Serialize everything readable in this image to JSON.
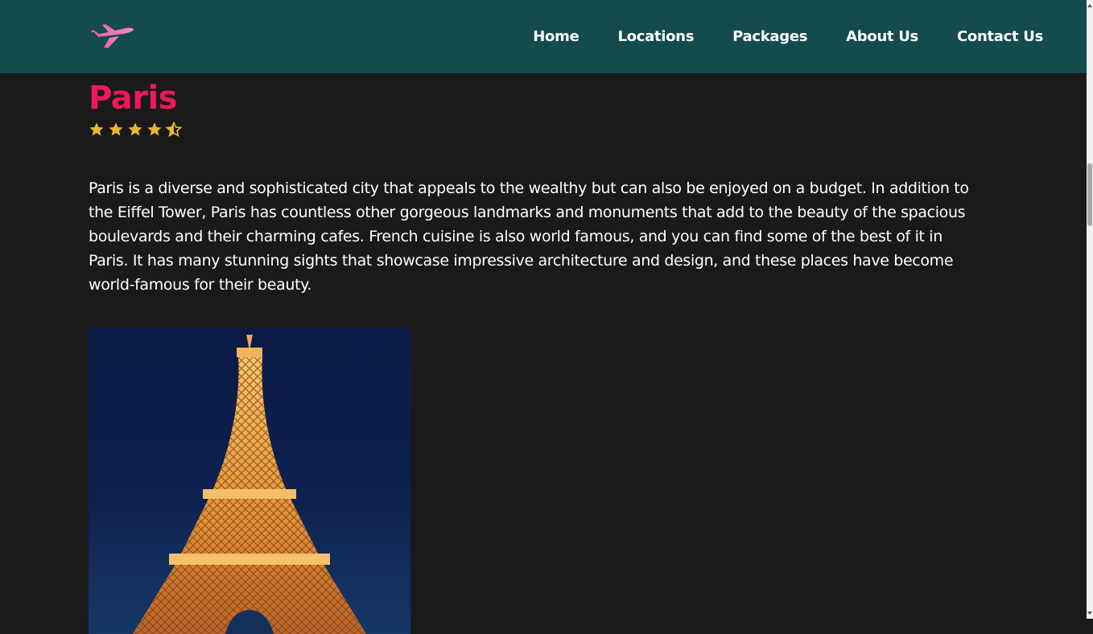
{
  "nav": {
    "logo_icon": "airplane-icon",
    "links": [
      "Home",
      "Locations",
      "Packages",
      "About Us",
      "Contact Us"
    ]
  },
  "destination": {
    "title": "Paris",
    "rating": 4.5,
    "rating_max": 5,
    "description": "Paris is a diverse and sophisticated city that appeals to the wealthy but can also be enjoyed on a budget. In addition to the Eiffel Tower, Paris has countless other gorgeous landmarks and monuments that add to the beauty of the spacious boulevards and their charming cafes. French cuisine is also world famous, and you can find some of the best of it in Paris. It has many stunning sights that showcase impressive architecture and design, and these places have become world-famous for their beauty."
  },
  "colors": {
    "navbar": "#144b4d",
    "background": "#1a1a1a",
    "title": "#f0185a",
    "star": "#e8b730",
    "logo": "#f06aa8"
  }
}
